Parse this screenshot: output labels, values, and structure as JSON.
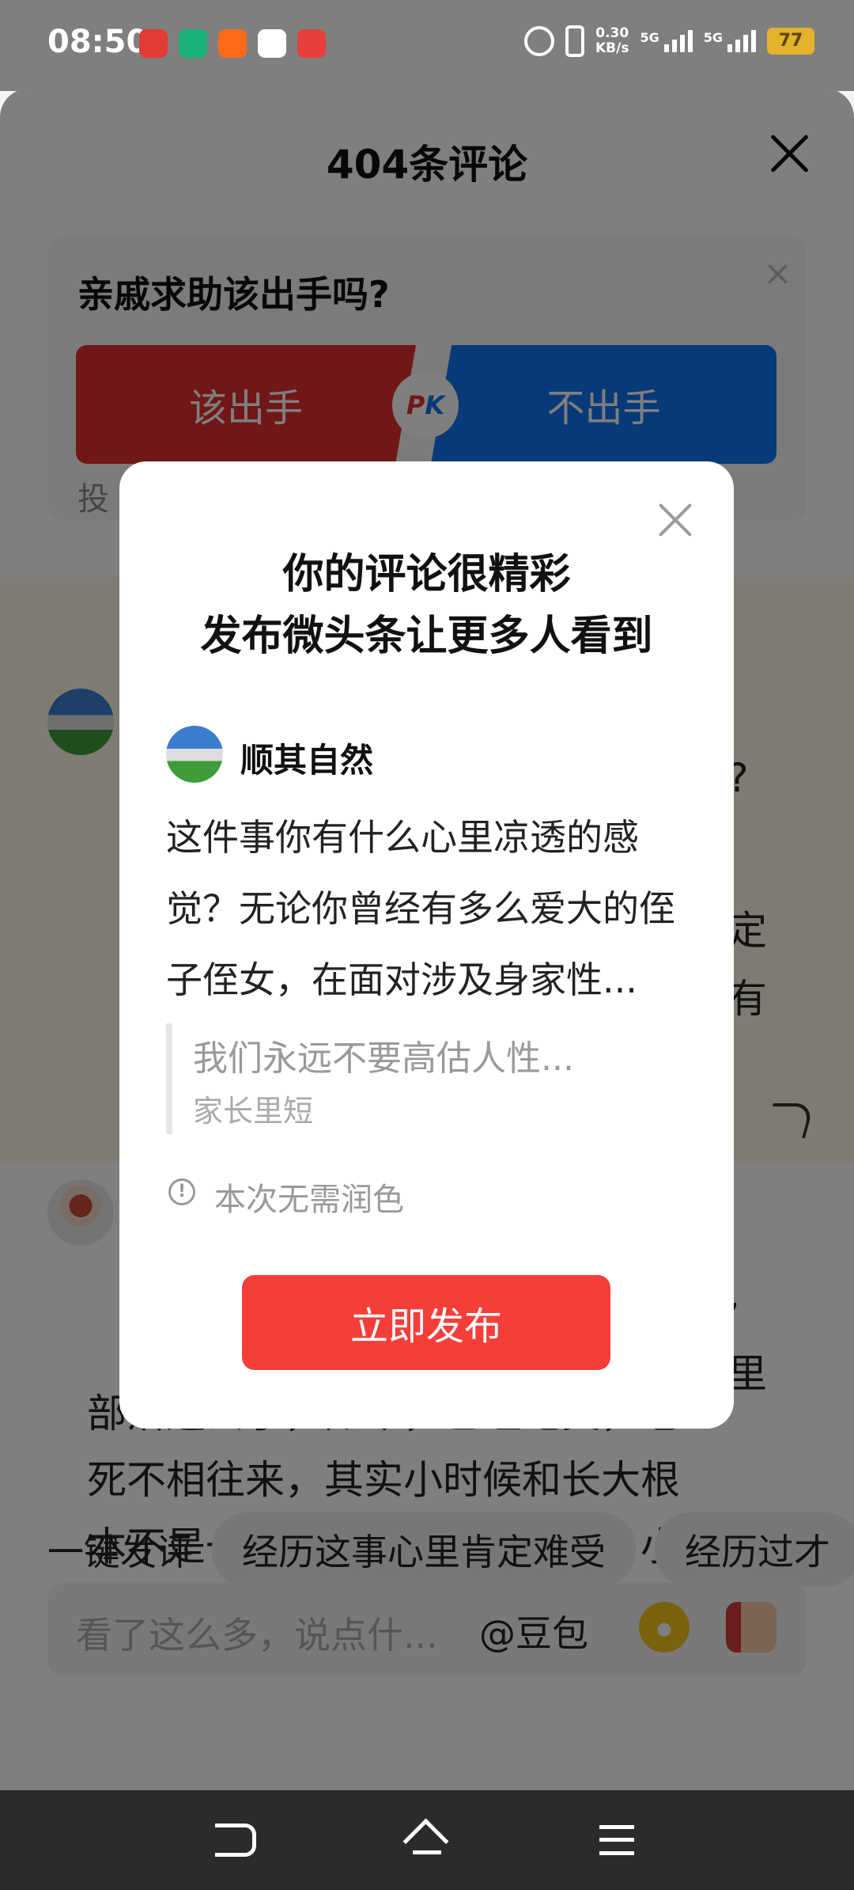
{
  "status_bar": {
    "time": "08:50",
    "net_speed_value": "0.30",
    "net_speed_unit": "KB/s",
    "sim1": "5G",
    "sim2": "5G",
    "battery": "77"
  },
  "sheet": {
    "title": "404条评论"
  },
  "pk": {
    "question": "亲戚求助该出手吗?",
    "left_option": "该出手",
    "right_option": "不出手",
    "badge_p": "P",
    "badge_k": "K",
    "sub_text": "投"
  },
  "comments": {
    "c1_frag_1": "?",
    "c1_frag_2": "定",
    "c1_frag_3": "有",
    "c2_frag_1": ",",
    "c2_frag_2": "里",
    "c2_line_1": "部落还去了，如今，已经绝交，老",
    "c2_line_2": "死不相往来，其实小时候和长大根",
    "c2_line_3": "本不是一回事，包括兄弟姐妹，小"
  },
  "quick_reply": {
    "label": "一键发评",
    "chips": [
      "经历这事心里肯定难受",
      "经历过才"
    ]
  },
  "input": {
    "placeholder": "看了这么多，说点什...",
    "doubao": "@豆包"
  },
  "dialog": {
    "title_line1": "你的评论很精彩",
    "title_line2": "发布微头条让更多人看到",
    "author": "顺其自然",
    "body": "这件事你有什么心里凉透的感觉？无论你曾经有多么爱大的侄子侄女，在面对涉及身家性...",
    "quote_title": "我们永远不要高估人性...",
    "quote_source": "家长里短",
    "note_icon": "!",
    "note": "本次无需润色",
    "publish_button": "立即发布"
  },
  "colors": {
    "accent_red": "#f53e3a",
    "pk_red": "#e0312f",
    "pk_blue": "#1174f2"
  },
  "icons": [
    "alarm-icon",
    "vibrate-icon",
    "signal-icon",
    "battery-icon",
    "close-icon",
    "share-icon",
    "grin-emoji-icon",
    "thumbs-up-icon",
    "info-icon",
    "back-icon",
    "home-icon",
    "menu-icon"
  ]
}
